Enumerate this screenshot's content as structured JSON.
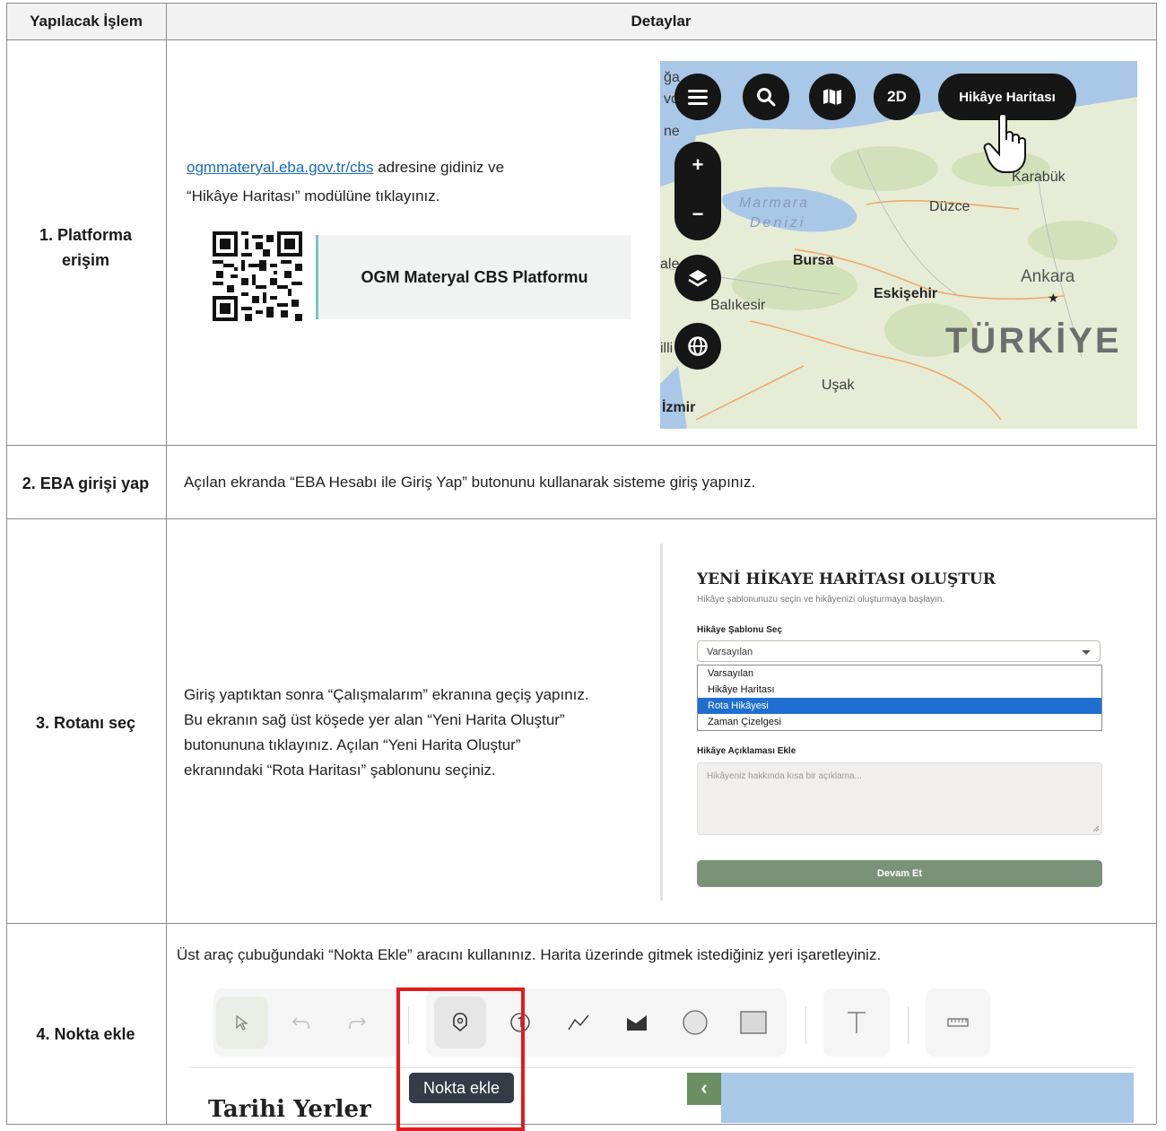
{
  "header": {
    "col1": "Yapılacak İşlem",
    "col2": "Detaylar"
  },
  "rows": [
    {
      "step": "1. Platforma erişim",
      "link_text": "ogmmateryal.eba.gov.tr/cbs",
      "text_after_link": " adresine gidiniz ve",
      "text_line2": "“Hikâye Haritası” modülüne tıklayınız.",
      "platform_box": "OGM Materyal CBS Platformu",
      "map": {
        "buttons": {
          "mode": "2D",
          "story": "Hikâye Haritası",
          "zoom_in": "+",
          "zoom_out": "−"
        },
        "labels": {
          "marmara1": "Marmara",
          "marmara2": "Denizi",
          "duzce": "Düzce",
          "karabuk": "Karabük",
          "bursa": "Bursa",
          "balikesir": "Balıkesir",
          "eskisehir": "Eskişehir",
          "ankara": "Ankara",
          "turkiye": "TÜRKİYE",
          "usak": "Uşak",
          "izmir": "İzmir",
          "frag1": "ğa",
          "frag2": "vo",
          "frag3": "ne",
          "frag4": "ale",
          "frag5": "illi"
        }
      }
    },
    {
      "step": "2. EBA girişi yap",
      "text": "Açılan ekranda “EBA Hesabı ile Giriş Yap” butonunu kullanarak sisteme giriş yapınız."
    },
    {
      "step": "3. Rotanı seç",
      "lines": [
        "Giriş yaptıktan sonra “Çalışmalarım” ekranına geçiş yapınız.",
        "Bu ekranın sağ üst köşede yer alan “Yeni Harita Oluştur”",
        "butonununa tıklayınız. Açılan “Yeni Harita Oluştur”",
        "ekranındaki “Rota Haritası” şablonunu seçiniz."
      ],
      "form": {
        "title": "YENİ HİKAYE HARİTASI OLUŞTUR",
        "subtitle": "Hikâye şablonunuzu seçin ve hikâyenizi oluşturmaya başlayın.",
        "template_label": "Hikâye Şablonu Seç",
        "selected": "Varsayılan",
        "options": [
          "Varsayılan",
          "Hikâye Haritası",
          "Rota Hikâyesi",
          "Zaman Çizelgesi"
        ],
        "desc_label": "Hikâye Açıklaması Ekle",
        "desc_placeholder": "Hikâyeniz hakkında kısa bir açıklama...",
        "button": "Devam Et"
      }
    },
    {
      "step": "4. Nokta ekle",
      "text": "Üst araç çubuğundaki “Nokta Ekle” aracını kullanınız. Harita üzerinde gitmek istediğiniz yeri işaretleyiniz.",
      "tooltip": "Nokta ekle",
      "panel_fragment": "Tarihi Yerler"
    }
  ]
}
